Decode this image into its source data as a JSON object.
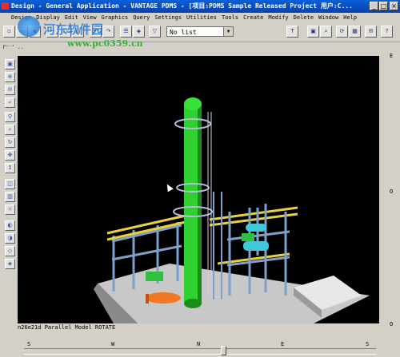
{
  "window": {
    "title": "Design - General Application - VANTAGE PDMS - [项目:PDMS Sample Released Project 用户:C...",
    "min_label": "_",
    "max_label": "□",
    "close_label": "×"
  },
  "menu": [
    "Design",
    "Display",
    "Edit",
    "View",
    "Graphics",
    "Query",
    "Settings",
    "Utilities",
    "Tools",
    "Create",
    "Modify",
    "Delete",
    "Window",
    "Help"
  ],
  "toolbar": {
    "list_combo_value": "No list"
  },
  "watermark": {
    "text": "河东软件园",
    "url": "www.pc0359.cn"
  },
  "navigator_label": "Navi...",
  "status": {
    "text": "n26e21d Parallel Model ROTATE"
  },
  "right_labels": [
    "E",
    "O",
    "O"
  ],
  "compass": [
    "S",
    "W",
    "N",
    "E",
    "S"
  ]
}
